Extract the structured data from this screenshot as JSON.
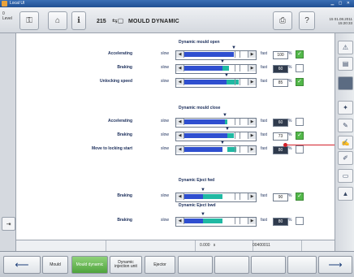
{
  "window": {
    "title": "Local UI"
  },
  "header": {
    "level_label": "Level",
    "level_value": "0",
    "page_number": "215",
    "page_title": "MOULD DYNAMIC",
    "date": "01.08.2011",
    "time": "15:20:33",
    "date_prefix": "15"
  },
  "labels": {
    "slow": "slow",
    "fast": "fast",
    "percent": "%"
  },
  "sections": [
    {
      "title": "Dynamic mould open",
      "rows": [
        {
          "label": "Accelerating",
          "fill": 0.8,
          "teal_start": 0.8,
          "teal_end": 0.8,
          "value": "100",
          "value_dark": false,
          "checked": true
        },
        {
          "label": "Braking",
          "fill": 0.62,
          "teal_start": 0.62,
          "teal_end": 0.72,
          "value": "60",
          "value_dark": true,
          "checked": false
        },
        {
          "label": "Unlocking speed",
          "fill": 0.68,
          "teal_start": 0.68,
          "teal_end": 0.88,
          "value": "85",
          "value_dark": false,
          "checked": true
        }
      ]
    },
    {
      "title": "Dynamic mould close",
      "rows": [
        {
          "label": "Accelerating",
          "fill": 0.66,
          "teal_start": 0.66,
          "teal_end": 0.7,
          "value": "60",
          "value_dark": true,
          "checked": false
        },
        {
          "label": "Braking",
          "fill": 0.7,
          "teal_start": 0.7,
          "teal_end": 0.8,
          "value": "73",
          "value_dark": false,
          "checked": true
        },
        {
          "label": "Move to locking start",
          "fill": 0.62,
          "teal_start": 0.7,
          "teal_end": 0.85,
          "value": "80",
          "value_dark": true,
          "checked": false
        }
      ]
    },
    {
      "title": "Dynamic Eject fwd",
      "rows": [
        {
          "label": "Braking",
          "fill": 0.3,
          "teal_start": 0.3,
          "teal_end": 0.62,
          "value": "90",
          "value_dark": false,
          "checked": true
        }
      ]
    },
    {
      "title": "Dynamic Eject bwd",
      "rows": [
        {
          "label": "Braking",
          "fill": 0.3,
          "teal_start": 0.3,
          "teal_end": 0.62,
          "value": "80",
          "value_dark": true,
          "checked": false
        }
      ]
    }
  ],
  "statusbar": {
    "cell1": "",
    "cell2": "",
    "value": "0.000",
    "unit": "s",
    "code": "00400011"
  },
  "bottom_nav": {
    "back_icon": "back-arrow-icon",
    "items": [
      "Mould",
      "Mould dynamic",
      "Dynamic injection unit",
      "Ejector"
    ],
    "active_index": 1,
    "forward_icon": "forward-arrow-icon"
  }
}
